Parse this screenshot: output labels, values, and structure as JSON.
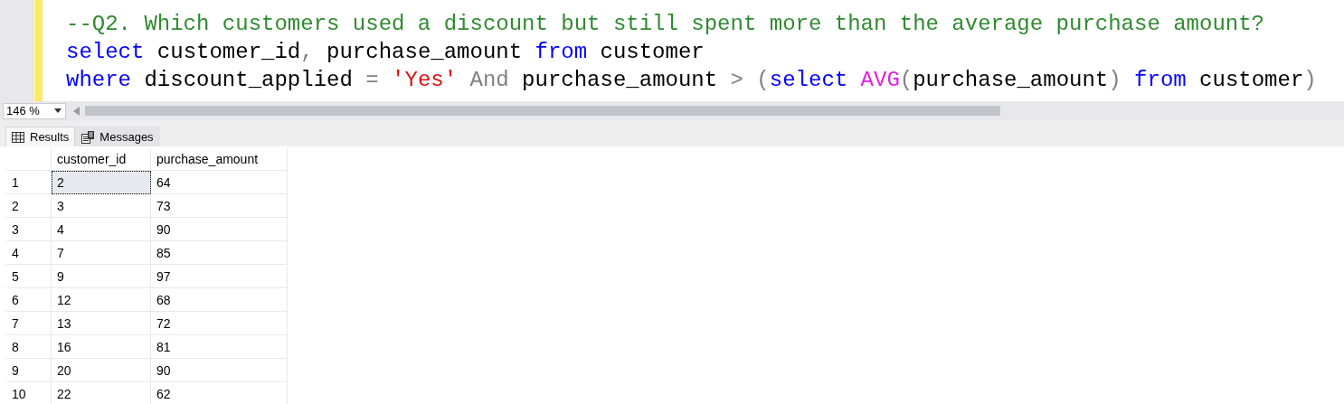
{
  "editor": {
    "lines": [
      {
        "tokens": [
          {
            "kind": "comment",
            "text": "--Q2. Which customers used a discount but still spent more than the average purchase amount?"
          }
        ]
      },
      {
        "tokens": [
          {
            "kind": "keyword",
            "text": "select"
          },
          {
            "kind": "plain",
            "text": " customer_id"
          },
          {
            "kind": "operator",
            "text": ","
          },
          {
            "kind": "plain",
            "text": " purchase_amount "
          },
          {
            "kind": "keyword",
            "text": "from"
          },
          {
            "kind": "plain",
            "text": " customer"
          }
        ]
      },
      {
        "tokens": [
          {
            "kind": "keyword",
            "text": "where"
          },
          {
            "kind": "plain",
            "text": " discount_applied "
          },
          {
            "kind": "operator",
            "text": "= "
          },
          {
            "kind": "string",
            "text": "'Yes'"
          },
          {
            "kind": "operator",
            "text": " And"
          },
          {
            "kind": "plain",
            "text": " purchase_amount "
          },
          {
            "kind": "operator",
            "text": "> ("
          },
          {
            "kind": "keyword",
            "text": "select "
          },
          {
            "kind": "function",
            "text": "AVG"
          },
          {
            "kind": "operator",
            "text": "("
          },
          {
            "kind": "plain",
            "text": "purchase_amount"
          },
          {
            "kind": "operator",
            "text": ") "
          },
          {
            "kind": "keyword",
            "text": "from"
          },
          {
            "kind": "plain",
            "text": " customer"
          },
          {
            "kind": "operator",
            "text": ")"
          }
        ]
      }
    ]
  },
  "zoom": {
    "value": "146 %"
  },
  "tabs": [
    {
      "label": "Results",
      "selected": true
    },
    {
      "label": "Messages",
      "selected": false
    }
  ],
  "grid": {
    "columns": [
      "customer_id",
      "purchase_amount"
    ],
    "rows": [
      {
        "number": "1",
        "cells": [
          {
            "text": "2",
            "selected": true
          },
          {
            "text": "64",
            "selected": false
          }
        ]
      },
      {
        "number": "2",
        "cells": [
          {
            "text": "3",
            "selected": false
          },
          {
            "text": "73",
            "selected": false
          }
        ]
      },
      {
        "number": "3",
        "cells": [
          {
            "text": "4",
            "selected": false
          },
          {
            "text": "90",
            "selected": false
          }
        ]
      },
      {
        "number": "4",
        "cells": [
          {
            "text": "7",
            "selected": false
          },
          {
            "text": "85",
            "selected": false
          }
        ]
      },
      {
        "number": "5",
        "cells": [
          {
            "text": "9",
            "selected": false
          },
          {
            "text": "97",
            "selected": false
          }
        ]
      },
      {
        "number": "6",
        "cells": [
          {
            "text": "12",
            "selected": false
          },
          {
            "text": "68",
            "selected": false
          }
        ]
      },
      {
        "number": "7",
        "cells": [
          {
            "text": "13",
            "selected": false
          },
          {
            "text": "72",
            "selected": false
          }
        ]
      },
      {
        "number": "8",
        "cells": [
          {
            "text": "16",
            "selected": false
          },
          {
            "text": "81",
            "selected": false
          }
        ]
      },
      {
        "number": "9",
        "cells": [
          {
            "text": "20",
            "selected": false
          },
          {
            "text": "90",
            "selected": false
          }
        ]
      },
      {
        "number": "10",
        "cells": [
          {
            "text": "22",
            "selected": false
          },
          {
            "text": "62",
            "selected": false
          }
        ]
      }
    ]
  }
}
